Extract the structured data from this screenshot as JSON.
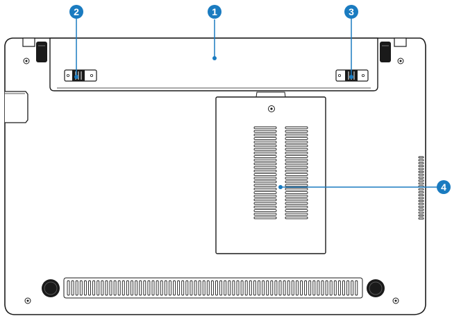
{
  "colors": {
    "callout": "#1a7bc0",
    "outline": "#1a1a1a",
    "body_fill": "#ffffff"
  },
  "callouts": [
    {
      "number": "1",
      "target": "battery-pack"
    },
    {
      "number": "2",
      "target": "battery-lock-left"
    },
    {
      "number": "3",
      "target": "battery-lock-right"
    },
    {
      "number": "4",
      "target": "memory-compartment"
    }
  ]
}
